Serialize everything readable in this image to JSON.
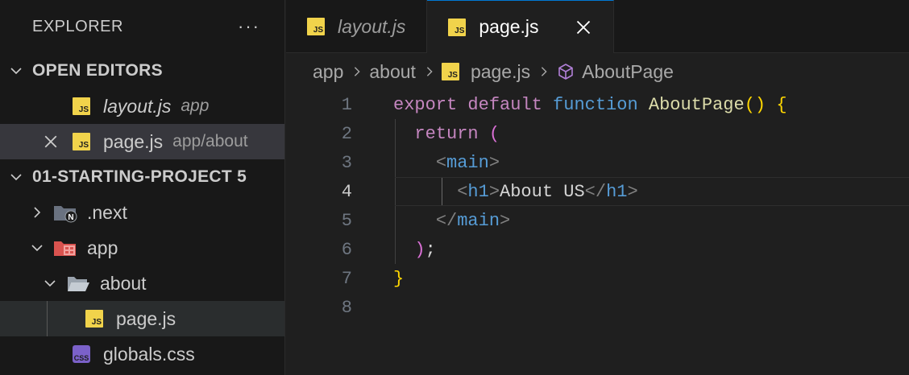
{
  "sidebar": {
    "title": "EXPLORER",
    "more_label": "···",
    "open_editors": {
      "header": "OPEN EDITORS",
      "items": [
        {
          "icon": "JS",
          "name": "layout.js",
          "path": "app"
        },
        {
          "icon": "JS",
          "name": "page.js",
          "path": "app/about"
        }
      ]
    },
    "project": {
      "header": "01-STARTING-PROJECT 5",
      "items": [
        {
          "name": ".next"
        },
        {
          "name": "app"
        },
        {
          "name": "about"
        },
        {
          "name": "page.js",
          "icon": "JS"
        },
        {
          "name": "globals.css",
          "icon": "CSS"
        }
      ]
    }
  },
  "tabs": [
    {
      "label": "layout.js",
      "icon": "JS"
    },
    {
      "label": "page.js",
      "icon": "JS"
    }
  ],
  "breadcrumb": {
    "items": [
      "app",
      "about",
      "page.js",
      "AboutPage"
    ]
  },
  "editor": {
    "line_numbers": [
      "1",
      "2",
      "3",
      "4",
      "5",
      "6",
      "7",
      "8"
    ],
    "tokens": {
      "export": "export",
      "default": "default",
      "function": "function",
      "fn_name": "AboutPage",
      "parens": "()",
      "brace_open": "{",
      "return": "return",
      "paren_open": "(",
      "lt": "<",
      "gt": ">",
      "lt_slash": "</",
      "main": "main",
      "h1": "h1",
      "h1_text": "About US",
      "paren_close": ")",
      "semicolon": ";",
      "brace_close": "}"
    }
  },
  "colors": {
    "keyword": "#c586c0",
    "keyword_blue": "#569cd6",
    "function": "#dcdcaa",
    "bracket_gold": "#ffd700",
    "bracket_pink": "#da70d6",
    "js_icon": "#f1d34b",
    "css_icon": "#7b61c9"
  }
}
